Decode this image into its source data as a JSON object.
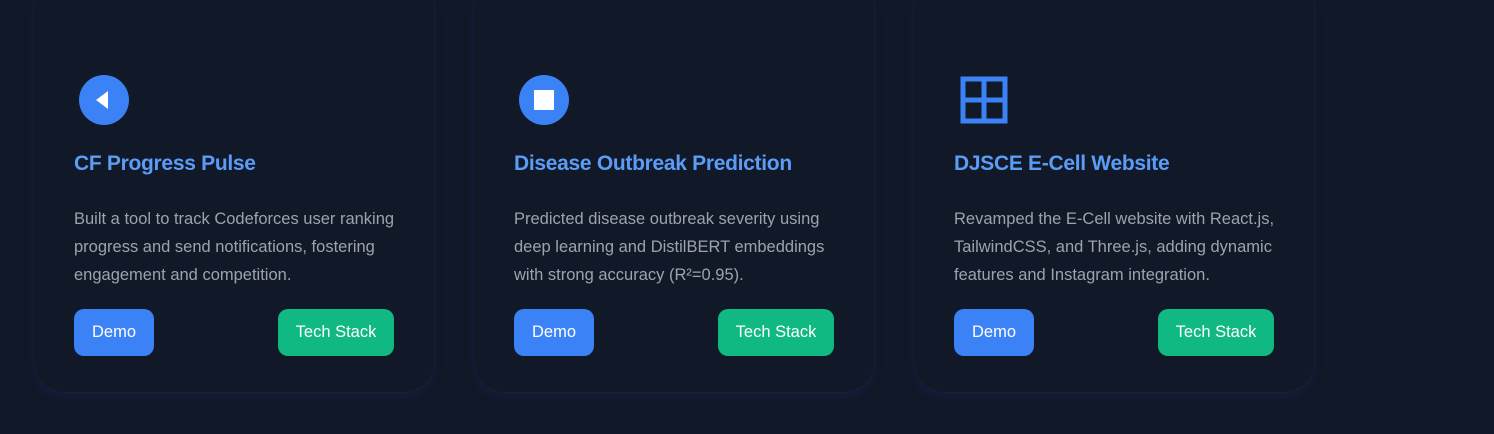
{
  "colors": {
    "background": "#111827",
    "accent_blue": "#3b82f6",
    "title_blue": "#5b9cf7",
    "accent_green": "#10b981",
    "description_gray": "#9ca3af"
  },
  "projects": [
    {
      "icon": "play-reverse-icon",
      "title": "CF Progress Pulse",
      "description": "Built a tool to track Codeforces user ranking progress and send notifications, fostering engagement and competition.",
      "demo_label": "Demo",
      "tech_label": "Tech Stack"
    },
    {
      "icon": "stop-icon",
      "title": "Disease Outbreak Prediction",
      "description": "Predicted disease outbreak severity using deep learning and DistilBERT embeddings with strong accuracy (R²=0.95).",
      "demo_label": "Demo",
      "tech_label": "Tech Stack"
    },
    {
      "icon": "grid-icon",
      "title": "DJSCE E-Cell Website",
      "description": "Revamped the E-Cell website with React.js, TailwindCSS, and Three.js, adding dynamic features and Instagram integration.",
      "demo_label": "Demo",
      "tech_label": "Tech Stack"
    }
  ]
}
